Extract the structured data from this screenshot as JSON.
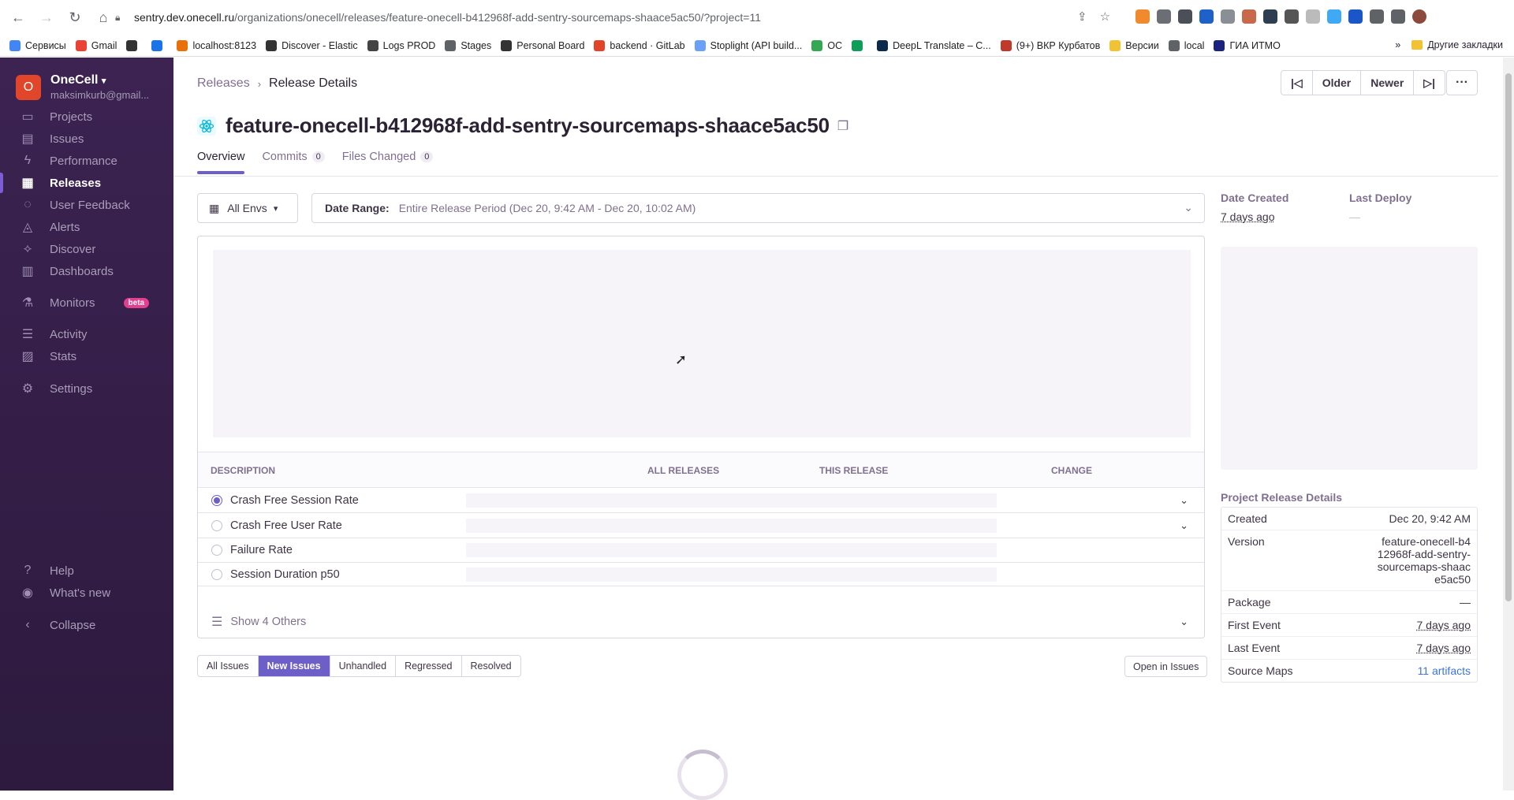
{
  "browser": {
    "url_host": "sentry.dev.onecell.ru",
    "url_path": "/organizations/onecell/releases/feature-onecell-b412968f-add-sentry-sourcemaps-shaace5ac50/?project=11",
    "bookmarks": [
      "Сервисы",
      "Gmail",
      "",
      "",
      "localhost:8123",
      "Discover - Elastic",
      "Logs PROD",
      "Stages",
      "Personal Board",
      "backend · GitLab",
      "Stoplight (API build...",
      "ОС",
      "",
      "DeepL Translate – С...",
      "(9+) ВКР Курбатов",
      "Версии",
      "local",
      "ГИА ИТМО"
    ],
    "bookmarks_more": "»",
    "other_bookmarks": "Другие закладки"
  },
  "sidebar": {
    "org_initial": "O",
    "org_name": "OneCell",
    "org_email": "maksimkurb@gmail...",
    "items": [
      {
        "label": "Projects",
        "icon": "projects-icon"
      },
      {
        "label": "Issues",
        "icon": "issues-icon"
      },
      {
        "label": "Performance",
        "icon": "performance-icon"
      },
      {
        "label": "Releases",
        "icon": "releases-icon"
      },
      {
        "label": "User Feedback",
        "icon": "feedback-icon"
      },
      {
        "label": "Alerts",
        "icon": "alerts-icon"
      },
      {
        "label": "Discover",
        "icon": "discover-icon"
      },
      {
        "label": "Dashboards",
        "icon": "dashboards-icon"
      },
      {
        "label": "Monitors",
        "icon": "monitors-icon",
        "badge": "beta"
      },
      {
        "label": "Activity",
        "icon": "activity-icon"
      },
      {
        "label": "Stats",
        "icon": "stats-icon"
      },
      {
        "label": "Settings",
        "icon": "settings-icon"
      }
    ],
    "help": "Help",
    "whats_new": "What's new",
    "collapse": "Collapse"
  },
  "breadcrumbs": {
    "parent": "Releases",
    "current": "Release Details"
  },
  "pager": {
    "older": "Older",
    "newer": "Newer",
    "more": "···"
  },
  "release": {
    "title": "feature-onecell-b412968f-add-sentry-sourcemaps-shaace5ac50"
  },
  "tabs": [
    {
      "label": "Overview"
    },
    {
      "label": "Commits",
      "count": "0"
    },
    {
      "label": "Files Changed",
      "count": "0"
    }
  ],
  "filters": {
    "envs": "All Envs",
    "date_range_label": "Date Range:",
    "date_range_value": "Entire Release Period (Dec 20, 9:42 AM - Dec 20, 10:02 AM)"
  },
  "metrics": {
    "headers": {
      "description": "DESCRIPTION",
      "all": "ALL RELEASES",
      "this": "THIS RELEASE",
      "change": "CHANGE"
    },
    "rows": [
      "Crash Free Session Rate",
      "Crash Free User Rate",
      "Failure Rate",
      "Session Duration p50"
    ],
    "show_others": "Show 4 Others"
  },
  "issue_filters": [
    "All Issues",
    "New Issues",
    "Unhandled",
    "Regressed",
    "Resolved"
  ],
  "open_in_issues": "Open in Issues",
  "side": {
    "date_created_label": "Date Created",
    "date_created_value": "7 days ago",
    "last_deploy_label": "Last Deploy",
    "last_deploy_value": "—",
    "project_details_title": "Project Release Details",
    "details": [
      {
        "k": "Created",
        "v": "Dec 20, 9:42 AM"
      },
      {
        "k": "Version",
        "v": "feature-onecell-b412968f-add-sentry-sourcemaps-shaace5ac50"
      },
      {
        "k": "Package",
        "v": "—"
      },
      {
        "k": "First Event",
        "v": "7 days ago"
      },
      {
        "k": "Last Event",
        "v": "7 days ago"
      },
      {
        "k": "Source Maps",
        "v": "11 artifacts"
      }
    ]
  },
  "colors": {
    "accent": "#6c5fc7",
    "sidebar": "#3c2352",
    "org": "#e1462a",
    "beta": "#e63e8f",
    "link": "#3d74db"
  }
}
